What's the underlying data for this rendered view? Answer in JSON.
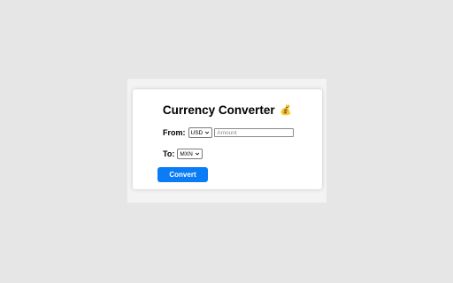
{
  "converter": {
    "title": "Currency Converter",
    "title_icon": "money-bag-icon",
    "title_icon_glyph": "💰",
    "from_label": "From:",
    "from_currency": "USD",
    "amount_placeholder": "Amount",
    "amount_value": "",
    "to_label": "To:",
    "to_currency": "MXN",
    "convert_label": "Convert"
  },
  "colors": {
    "background": "#e6e6e6",
    "card": "#ffffff",
    "accent": "#0a7cf5"
  }
}
